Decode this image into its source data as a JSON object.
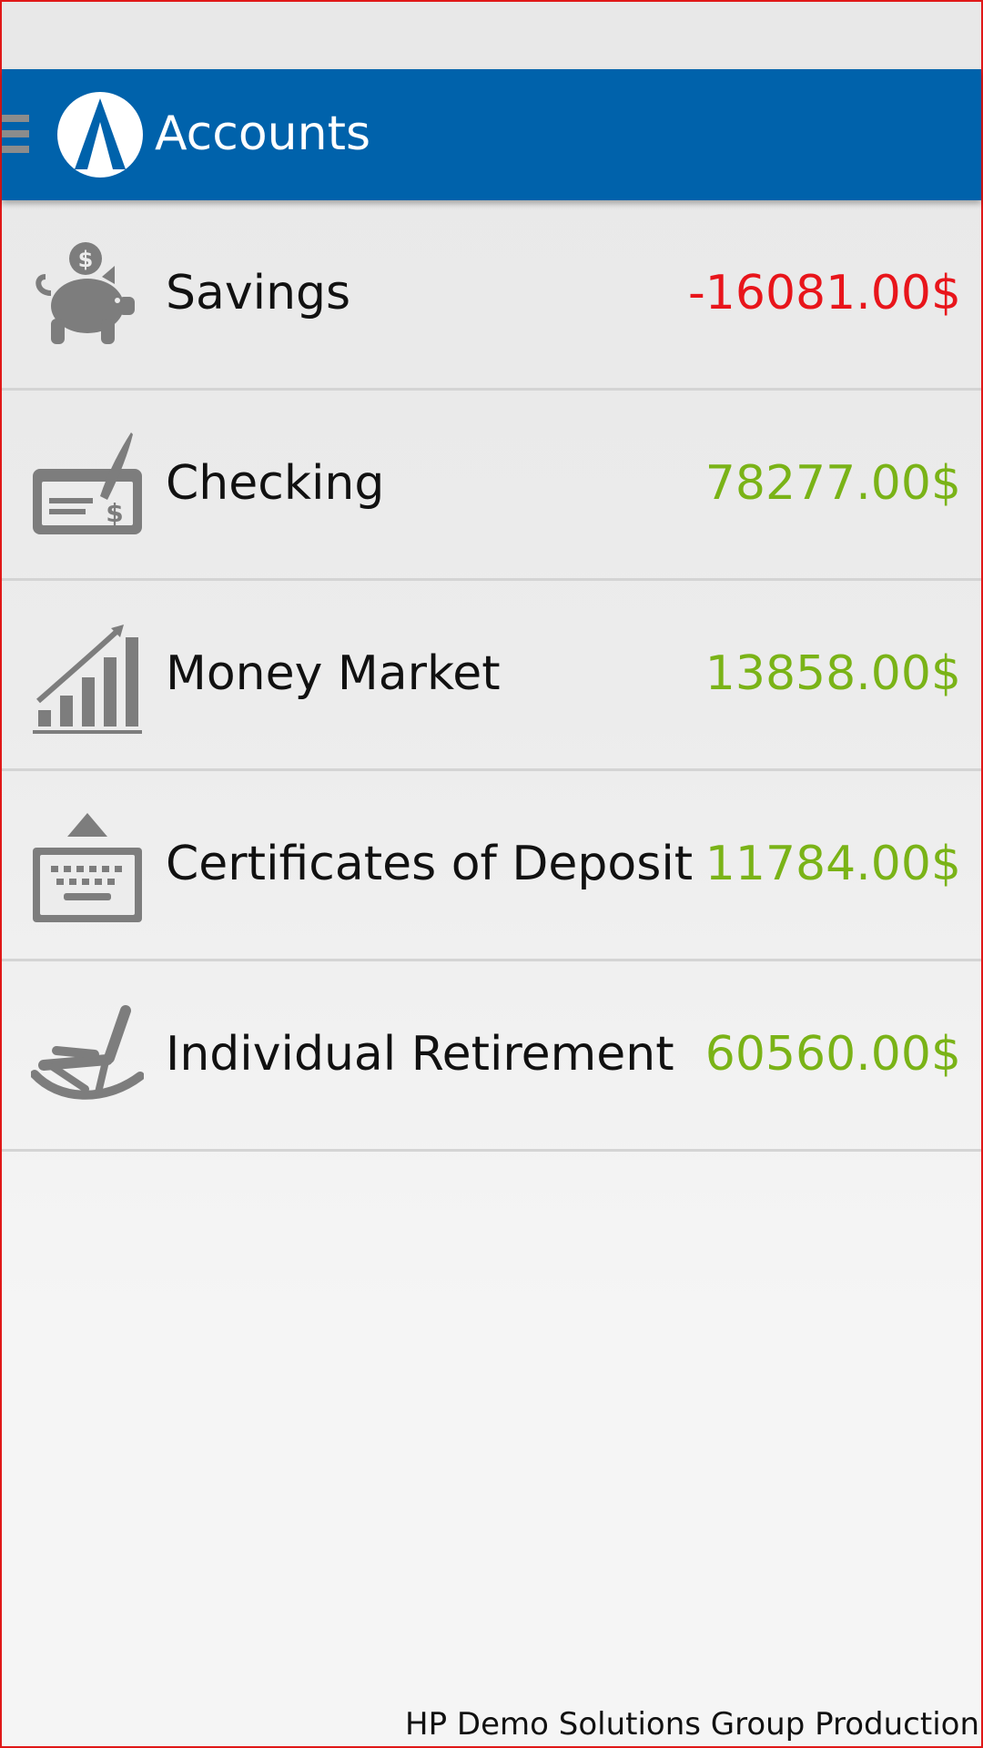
{
  "app_bar": {
    "title": "Accounts",
    "background_color": "#0062ab",
    "menu_icon": "hamburger-menu-icon",
    "logo_icon": "app-logo-icon"
  },
  "colors": {
    "negative": "#e8151b",
    "positive": "#7ab317",
    "icon_gray": "#7d7d7d"
  },
  "accounts": [
    {
      "name": "Savings",
      "balance": "-16081.00$",
      "status": "negative",
      "icon": "piggy-bank-icon"
    },
    {
      "name": "Checking",
      "balance": "78277.00$",
      "status": "positive",
      "icon": "check-icon"
    },
    {
      "name": "Money Market",
      "balance": "13858.00$",
      "status": "positive",
      "icon": "growth-chart-icon"
    },
    {
      "name": "Certificates of Deposit",
      "balance": "11784.00$",
      "status": "positive",
      "icon": "keyboard-icon"
    },
    {
      "name": "Individual Retirement",
      "balance": "60560.00$",
      "status": "positive",
      "icon": "rocking-chair-icon"
    }
  ],
  "footer": {
    "text": "HP Demo Solutions Group Production"
  }
}
